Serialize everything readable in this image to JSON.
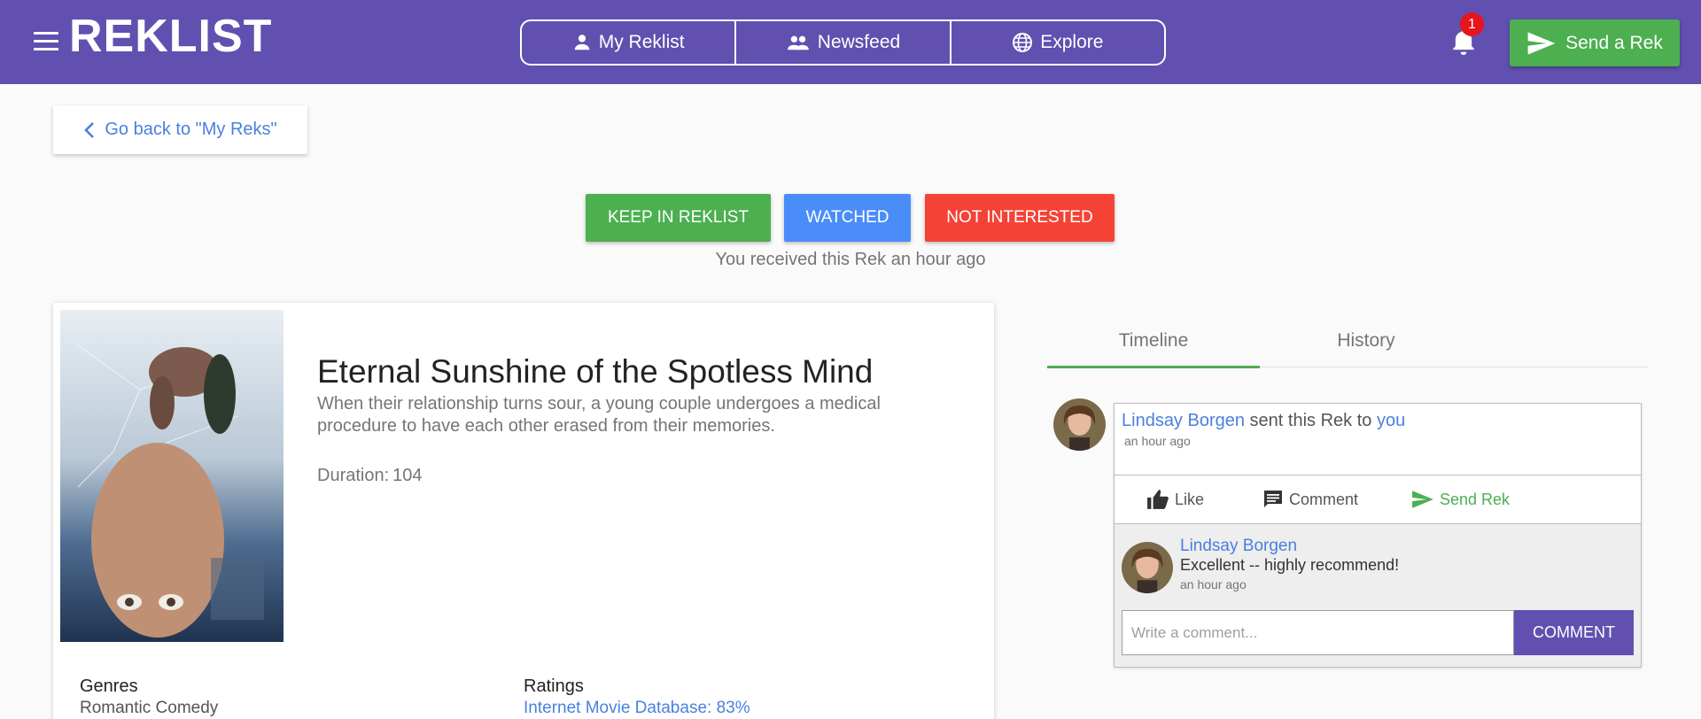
{
  "header": {
    "logo_text": "REKLIST",
    "nav": [
      {
        "label": "My Reklist",
        "icon": "person-icon"
      },
      {
        "label": "Newsfeed",
        "icon": "people-icon"
      },
      {
        "label": "Explore",
        "icon": "globe-icon"
      }
    ],
    "notification_count": "1",
    "send_rek_label": "Send a Rek"
  },
  "back_button": {
    "label": "Go back to \"My Reks\""
  },
  "actions": {
    "keep": "Keep in Reklist",
    "watched": "Watched",
    "not_interested": "Not interested",
    "received_text": "You received this Rek",
    "received_time": "an hour ago"
  },
  "movie": {
    "title": "Eternal Sunshine of the Spotless Mind",
    "description": "When their relationship turns sour, a young couple undergoes a medical procedure to have each other erased from their memories.",
    "duration_label": "Duration:",
    "duration_value": "104",
    "genres_label": "Genres",
    "genres_value": "Romantic Comedy",
    "ratings_label": "Ratings",
    "ratings_value": "Internet Movie Database: 83%"
  },
  "tabs": [
    {
      "label": "Timeline",
      "active": true
    },
    {
      "label": "History",
      "active": false
    }
  ],
  "timeline": {
    "sender": "Lindsay Borgen",
    "sent_text": "sent this Rek to",
    "recipient": "you",
    "time": "an hour ago",
    "like_label": "Like",
    "comment_label": "Comment",
    "send_rek_label": "Send Rek",
    "comment": {
      "author": "Lindsay Borgen",
      "text": "Excellent -- highly recommend!",
      "time": "an hour ago"
    },
    "input_placeholder": "Write a comment...",
    "comment_button": "Comment"
  },
  "colors": {
    "header_bg": "#6150b0",
    "green": "#4caf50",
    "blue": "#4a8df8",
    "red": "#f44336",
    "link": "#4a7fe0"
  }
}
